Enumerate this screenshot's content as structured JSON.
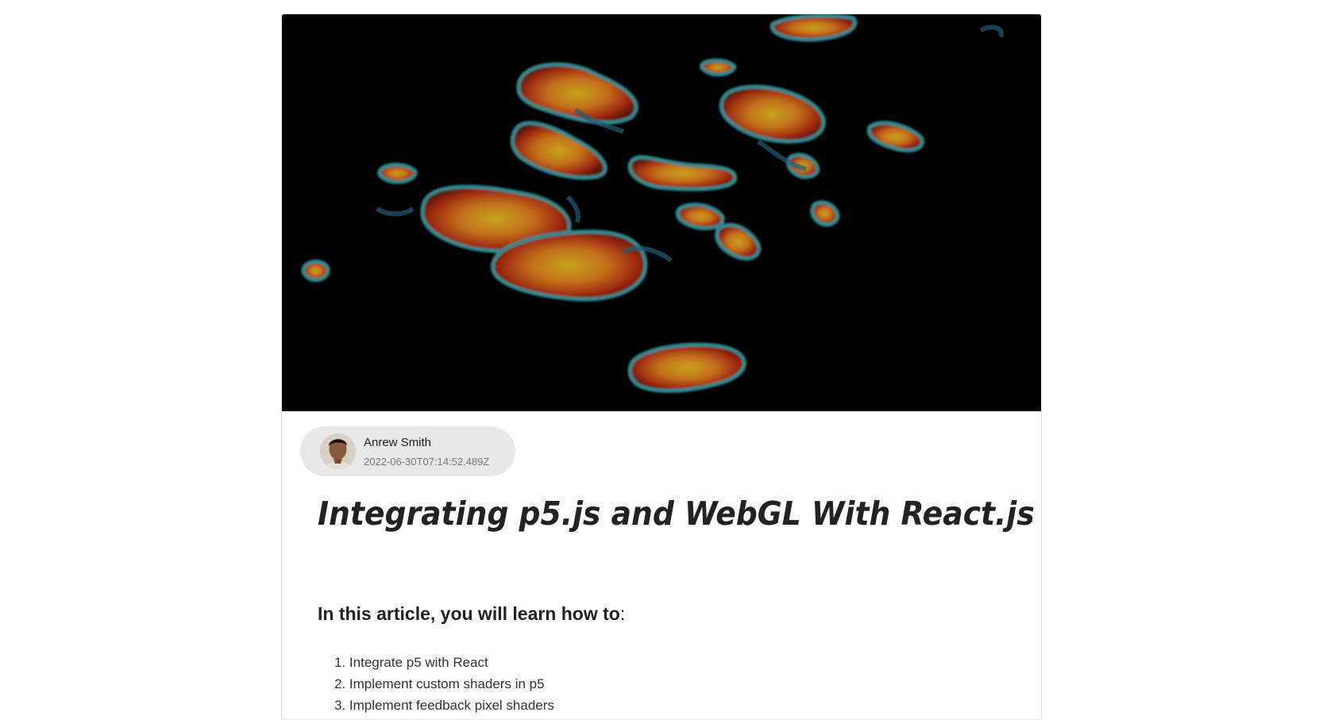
{
  "hero": {
    "icon": "webgl-shader-blob-image"
  },
  "author": {
    "name": "Anrew Smith",
    "date": "2022-06-30T07:14:52.489Z",
    "avatar_icon": "author-avatar"
  },
  "article": {
    "title": "Integrating p5.js and WebGL With React.js",
    "intro_bold": "In this article, you will learn how to",
    "intro_suffix": ":",
    "steps": [
      {
        "number": "1.",
        "text": "Integrate p5 with React"
      },
      {
        "number": "2.",
        "text": "Implement custom shaders in p5"
      },
      {
        "number": "3.",
        "text": "Implement feedback pixel shaders"
      }
    ]
  },
  "colors": {
    "page_background": "#ffffff",
    "chip_background": "#e8e8e8",
    "text": "#222222",
    "blob_core": "#c43f12",
    "blob_edge": "#2f8a8f"
  }
}
